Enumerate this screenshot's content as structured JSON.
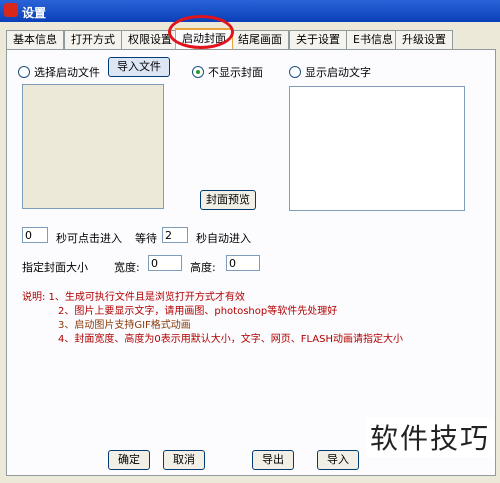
{
  "window": {
    "title": "设置"
  },
  "tabs": [
    "基本信息",
    "打开方式",
    "权限设置",
    "启动封面",
    "结尾画面",
    "关于设置",
    "E书信息",
    "升级设置"
  ],
  "radio_start_file": "选择启动文件",
  "btn_import": "导入文件",
  "radio_no_cover": "不显示封面",
  "radio_show_text": "显示启动文字",
  "btn_preview": "封面预览",
  "seconds_value": "0",
  "seconds_label": "秒可点击进入",
  "wait_label": "等待",
  "wait_value": "2",
  "auto_label": "秒自动进入",
  "cover_size_label": "指定封面大小",
  "width_label": "宽度:",
  "width_value": "0",
  "height_label": "高度:",
  "height_value": "0",
  "notes": [
    "说明: 1、生成可执行文件且是浏览打开方式才有效",
    "2、图片上要显示文字，请用画图、photoshop等软件先处理好",
    "3、启动图片支持GIF格式动画",
    "4、封面宽度、高度为0表示用默认大小，文字、网页、FLASH动画请指定大小"
  ],
  "footer": {
    "ok": "确定",
    "cancel": "取消",
    "export": "导出",
    "import": "导入"
  },
  "watermark": "软件技巧"
}
